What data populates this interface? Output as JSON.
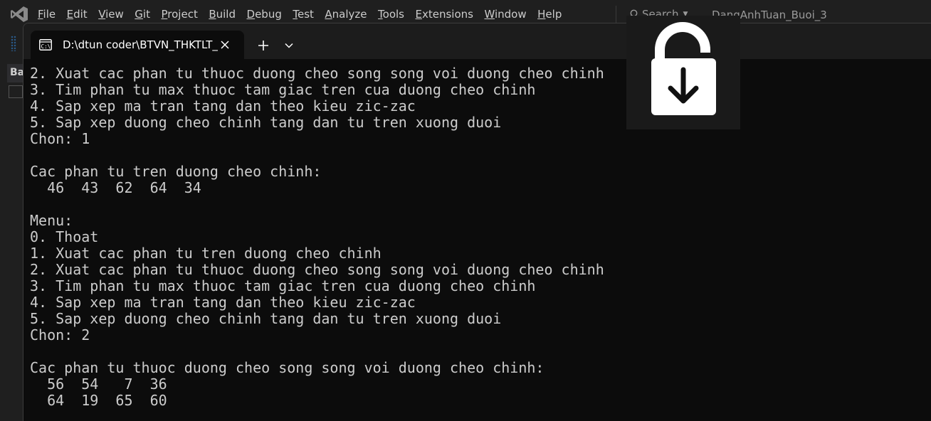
{
  "vs": {
    "menu": [
      "File",
      "Edit",
      "View",
      "Git",
      "Project",
      "Build",
      "Debug",
      "Test",
      "Analyze",
      "Tools",
      "Extensions",
      "Window",
      "Help"
    ],
    "search_label": "Search",
    "project_name": "DangAnhTuan_Buoi_3",
    "left_strip_label": "Ba"
  },
  "terminal": {
    "tab_title": "D:\\dtun coder\\BTVN_THKTLT_",
    "lines": [
      "2. Xuat cac phan tu thuoc duong cheo song song voi duong cheo chinh",
      "3. Tim phan tu max thuoc tam giac tren cua duong cheo chinh",
      "4. Sap xep ma tran tang dan theo kieu zic-zac",
      "5. Sap xep duong cheo chinh tang dan tu tren xuong duoi",
      "Chon: 1",
      "",
      "Cac phan tu tren duong cheo chinh:",
      "  46  43  62  64  34",
      "",
      "Menu:",
      "0. Thoat",
      "1. Xuat cac phan tu tren duong cheo chinh",
      "2. Xuat cac phan tu thuoc duong cheo song song voi duong cheo chinh",
      "3. Tim phan tu max thuoc tam giac tren cua duong cheo chinh",
      "4. Sap xep ma tran tang dan theo kieu zic-zac",
      "5. Sap xep duong cheo chinh tang dan tu tren xuong duoi",
      "Chon: 2",
      "",
      "Cac phan tu thuoc duong cheo song song voi duong cheo chinh:",
      "  56  54   7  36",
      "  64  19  65  60"
    ]
  },
  "overlay": {
    "icon": "unlock-download-icon"
  },
  "colors": {
    "terminal_bg": "#0c0c0c",
    "terminal_text": "#cccccc",
    "vs_bg": "#1f1f1f",
    "overlay_bg": "#1a1a1a"
  }
}
